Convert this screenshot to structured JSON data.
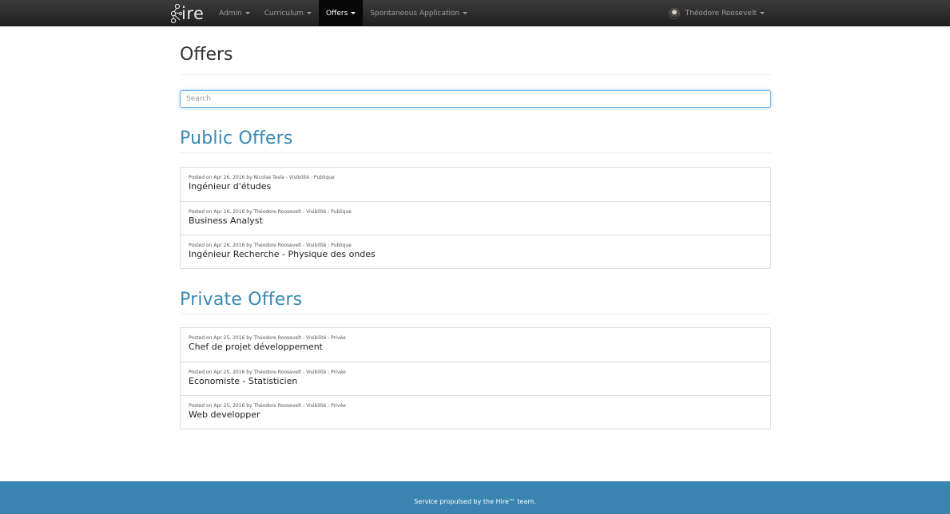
{
  "navbar": {
    "brand": "ire",
    "menu": [
      {
        "label": "Admin",
        "active": false
      },
      {
        "label": "Curriculum",
        "active": false
      },
      {
        "label": "Offers",
        "active": true
      },
      {
        "label": "Spontaneous Application",
        "active": false
      }
    ],
    "user": "Théodore Roosevelt",
    "colors": {
      "background": "#2b2b2b",
      "active": "#080808"
    }
  },
  "page": {
    "title": "Offers",
    "search_placeholder": "Search"
  },
  "public_offers": {
    "heading": "Public Offers",
    "items": [
      {
        "meta": "Posted on Apr 26, 2016 by Nicolas Tesla - Visibilité : Publique",
        "title": "Ingénieur d'études"
      },
      {
        "meta": "Posted on Apr 26, 2016 by Théodore Roosevelt - Visibilité : Publique",
        "title": "Business Analyst"
      },
      {
        "meta": "Posted on Apr 26, 2016 by Théodore Roosevelt - Visibilité : Publique",
        "title": "Ingénieur Recherche - Physique des ondes"
      }
    ]
  },
  "private_offers": {
    "heading": "Private Offers",
    "items": [
      {
        "meta": "Posted on Apr 25, 2016 by Théodore Roosevelt - Visibilité : Privée",
        "title": "Chef de projet développement"
      },
      {
        "meta": "Posted on Apr 25, 2016 by Théodore Roosevelt - Visibilité : Privée",
        "title": "Economiste - Statisticien"
      },
      {
        "meta": "Posted on Apr 25, 2016 by Théodore Roosevelt - Visibilité : Privée",
        "title": "Web developper"
      }
    ]
  },
  "footer": {
    "text": "Service propulsed by the Hire™ team.",
    "color": "#3a84b1"
  },
  "theme": {
    "accent": "#3a8ab5"
  }
}
